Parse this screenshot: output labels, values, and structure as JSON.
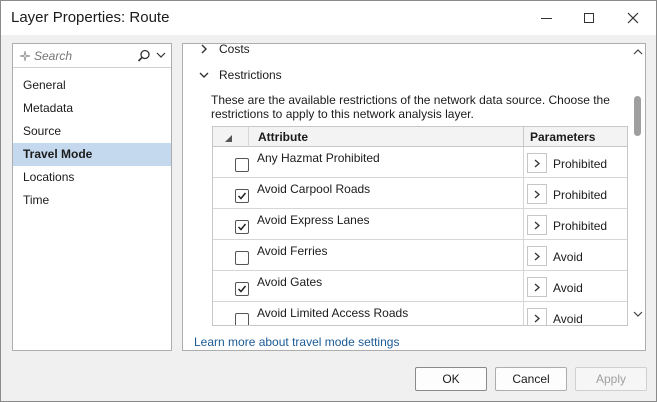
{
  "window": {
    "title": "Layer Properties: Route"
  },
  "sidebar": {
    "search_placeholder": "Search",
    "items": [
      {
        "label": "General",
        "active": false
      },
      {
        "label": "Metadata",
        "active": false
      },
      {
        "label": "Source",
        "active": false
      },
      {
        "label": "Travel Mode",
        "active": true
      },
      {
        "label": "Locations",
        "active": false
      },
      {
        "label": "Time",
        "active": false
      }
    ]
  },
  "main": {
    "sections": [
      {
        "label": "Costs",
        "expanded": false
      },
      {
        "label": "Restrictions",
        "expanded": true
      }
    ],
    "description": "These are the available restrictions of the network data source. Choose the restrictions to apply to this network analysis layer.",
    "table": {
      "headers": {
        "attribute": "Attribute",
        "parameters": "Parameters"
      },
      "rows": [
        {
          "name": "Any Hazmat Prohibited",
          "checked": false,
          "parameter": "Prohibited"
        },
        {
          "name": "Avoid Carpool Roads",
          "checked": true,
          "parameter": "Prohibited"
        },
        {
          "name": "Avoid Express Lanes",
          "checked": true,
          "parameter": "Prohibited"
        },
        {
          "name": "Avoid Ferries",
          "checked": false,
          "parameter": "Avoid"
        },
        {
          "name": "Avoid Gates",
          "checked": true,
          "parameter": "Avoid"
        },
        {
          "name": "Avoid Limited Access Roads",
          "checked": false,
          "parameter": "Avoid"
        }
      ]
    },
    "learn_link": "Learn more about travel mode settings"
  },
  "footer": {
    "ok_label": "OK",
    "cancel_label": "Cancel",
    "apply_label": "Apply",
    "apply_enabled": false
  }
}
